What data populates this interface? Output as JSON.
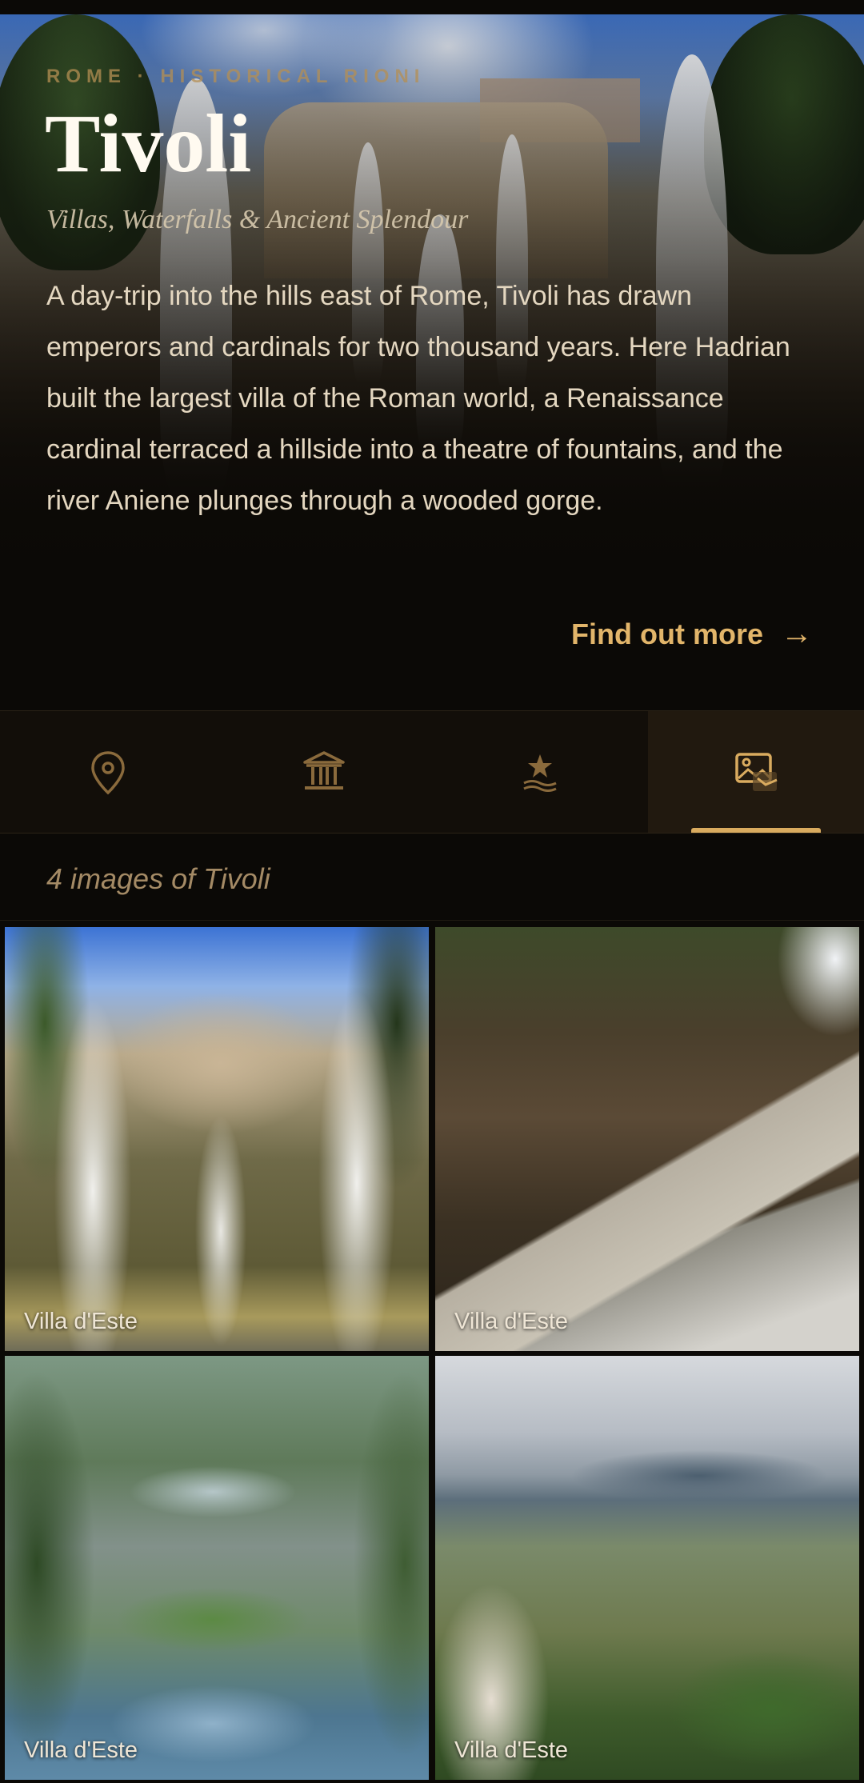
{
  "hero": {
    "eyebrow": "ROME · HISTORICAL RIONI",
    "title": "Tivoli",
    "subtitle": "Villas, Waterfalls & Ancient Splendour",
    "description": "A day-trip into the hills east of Rome, Tivoli has drawn emperors and cardinals for two thousand years. Here Hadrian built the largest villa of the Roman world, a Renaissance cardinal terraced a hillside into a theatre of fountains, and the river Aniene plunges through a wooded gorge.",
    "cta_label": "Find out more",
    "cta_arrow": "→"
  },
  "tabs": [
    {
      "icon": "map-pin-icon",
      "active": false
    },
    {
      "icon": "museum-icon",
      "active": false
    },
    {
      "icon": "star-wave-icon",
      "active": false
    },
    {
      "icon": "gallery-icon",
      "active": true
    }
  ],
  "gallery": {
    "count_label": "4 images of Tivoli",
    "images": [
      {
        "caption": "Villa d'Este"
      },
      {
        "caption": "Villa d'Este"
      },
      {
        "caption": "Villa d'Este"
      },
      {
        "caption": "Villa d'Este"
      }
    ]
  },
  "colors": {
    "accent": "#d9ab5f",
    "background": "#0b0906",
    "tab_active_bg": "#21190f"
  }
}
